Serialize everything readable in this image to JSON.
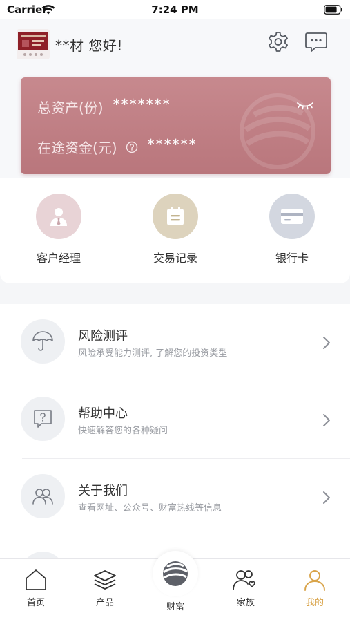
{
  "status_bar": {
    "carrier": "Carrier",
    "time": "7:24 PM"
  },
  "header": {
    "greeting": "**材  您好!"
  },
  "asset_card": {
    "total_label": "总资产(份)",
    "total_value": "*******",
    "transit_label": "在途资金(元)",
    "transit_value": "******"
  },
  "quick_actions": [
    {
      "label": "客户经理",
      "icon": "account-manager-icon",
      "color": "#e8d3d6"
    },
    {
      "label": "交易记录",
      "icon": "calendar-icon",
      "color": "#ddd3bd"
    },
    {
      "label": "银行卡",
      "icon": "bank-card-icon",
      "color": "#d3d7e0"
    }
  ],
  "menu": [
    {
      "title": "风险测评",
      "subtitle": "风险承受能力测评, 了解您的投资类型",
      "icon": "umbrella-icon"
    },
    {
      "title": "帮助中心",
      "subtitle": "快速解答您的各种疑问",
      "icon": "help-chat-icon"
    },
    {
      "title": "关于我们",
      "subtitle": "查看网址、公众号、财富热线等信息",
      "icon": "people-icon"
    }
  ],
  "tabbar": {
    "home": "首页",
    "products": "产品",
    "wealth": "财富",
    "family": "家族",
    "mine": "我的",
    "active_color": "#d9a44a"
  }
}
